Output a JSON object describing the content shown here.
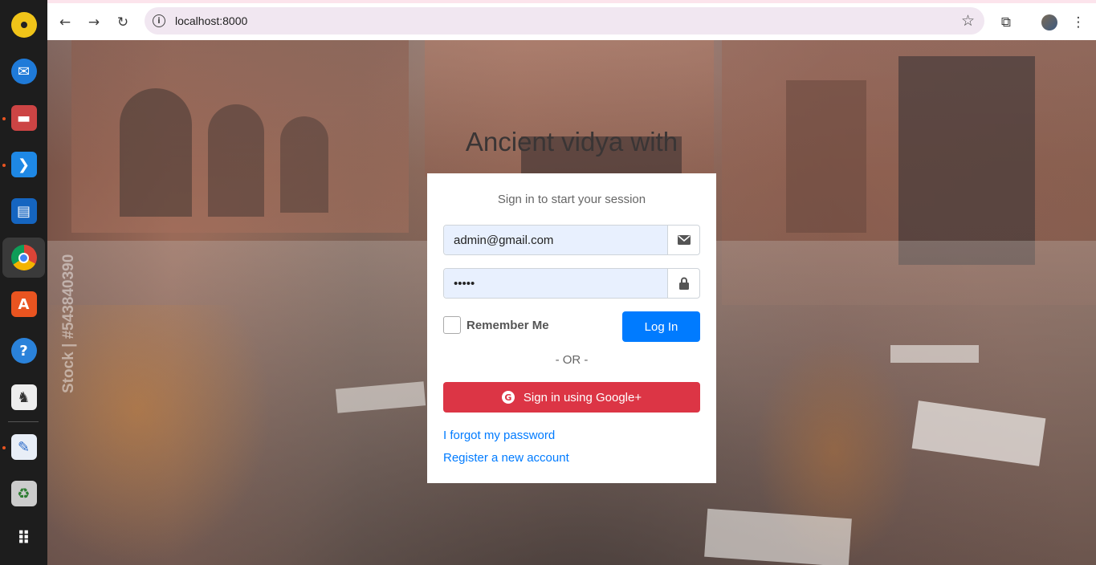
{
  "browser": {
    "url": "localhost:8000",
    "url_icon": "info-icon"
  },
  "dock": {
    "items": [
      "rhythmbox-icon",
      "thunderbird-icon",
      "files-icon",
      "vscode-icon",
      "writer-icon",
      "chrome-icon",
      "app-center-icon",
      "help-icon",
      "inkscape-icon",
      "text-editor-icon",
      "trash-icon",
      "app-grid-icon"
    ]
  },
  "page": {
    "heading": "Ancient vidya with",
    "watermark": "Stock | #543840390"
  },
  "login": {
    "message": "Sign in to start your session",
    "email_value": "admin@gmail.com",
    "password_value": "•••••",
    "remember_label": "Remember Me",
    "login_label": "Log In",
    "or_label": "- OR -",
    "google_label": "Sign in using Google+",
    "forgot_label": "I forgot my password",
    "register_label": "Register a new account"
  },
  "colors": {
    "primary": "#007bff",
    "danger": "#dc3545"
  }
}
